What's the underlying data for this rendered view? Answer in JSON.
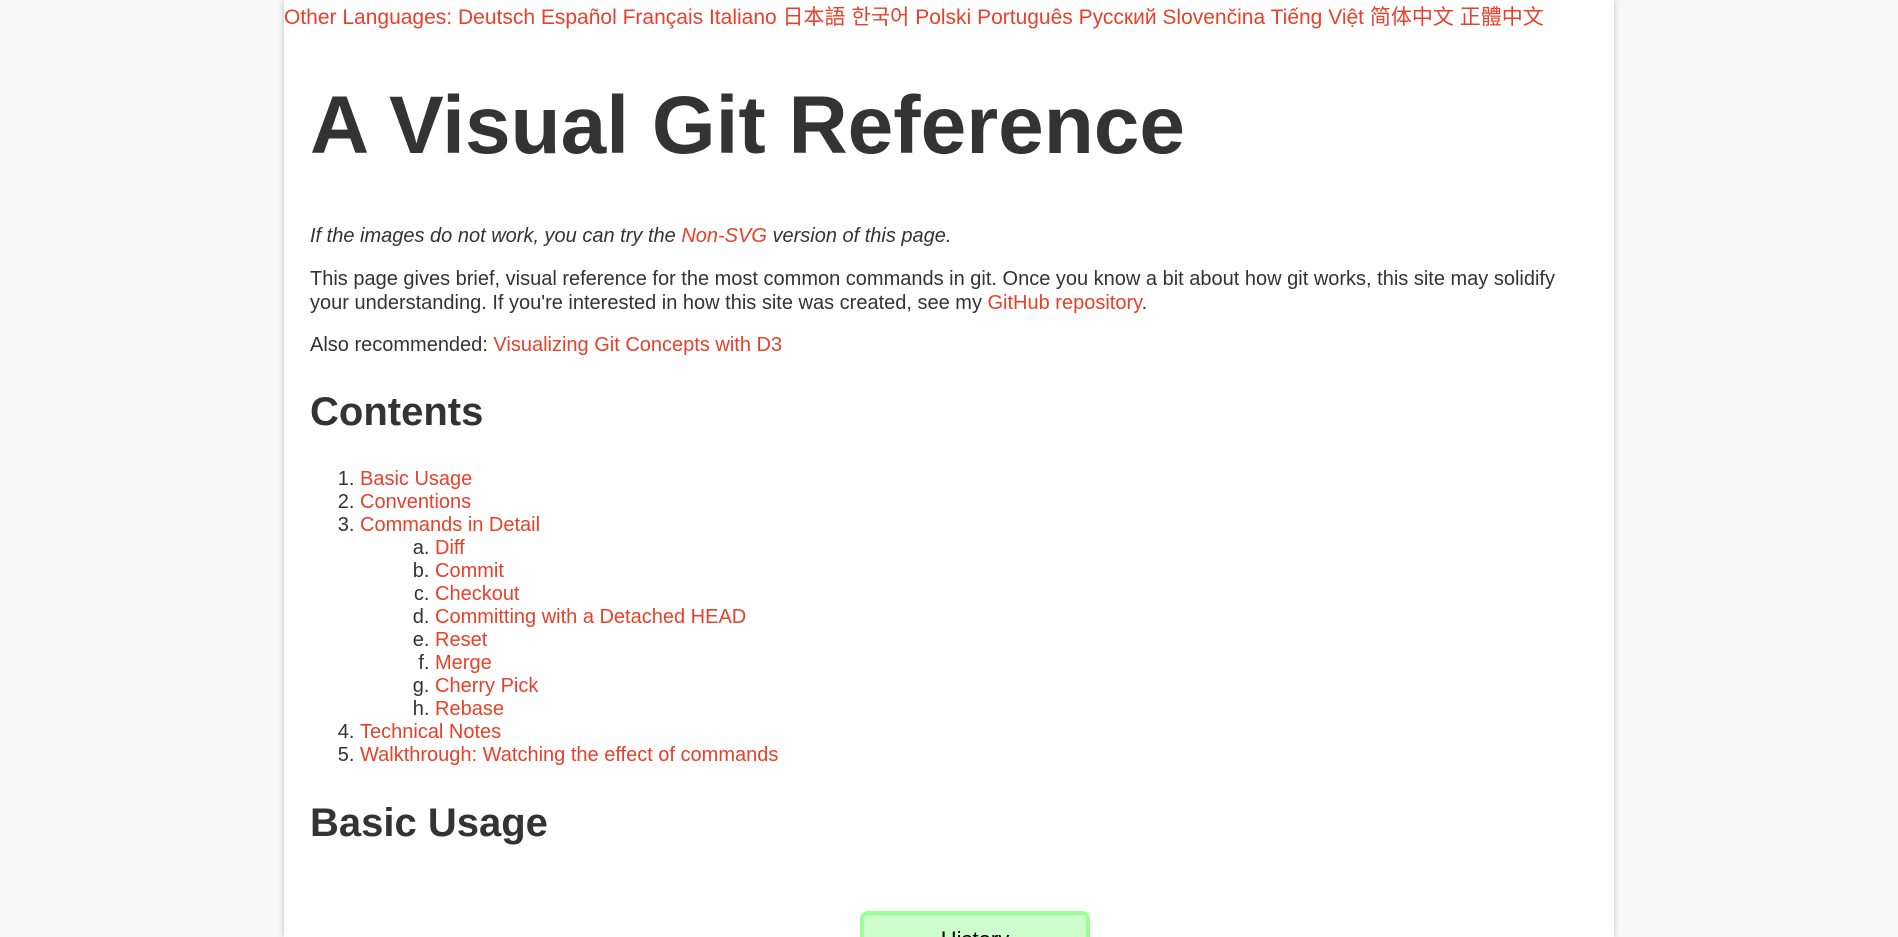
{
  "languages": {
    "label": "Other Languages:",
    "items": [
      "Deutsch",
      "Español",
      "Français",
      "Italiano",
      "日本語",
      "한국어",
      "Polski",
      "Português",
      "Русский",
      "Slovenčina",
      "Tiếng Việt",
      "简体中文",
      "正體中文"
    ]
  },
  "title": "A Visual Git Reference",
  "note": {
    "before": "If the images do not work, you can try the ",
    "link": "Non-SVG",
    "after": " version of this page."
  },
  "intro": {
    "text": "This page gives brief, visual reference for the most common commands in git. Once you know a bit about how git works, this site may solidify your understanding. If you're interested in how this site was created, see my ",
    "link": "GitHub repository",
    "end": "."
  },
  "also": {
    "label": "Also recommended: ",
    "link": "Visualizing Git Concepts with D3"
  },
  "contents_heading": "Contents",
  "toc": {
    "item1": "Basic Usage",
    "item2": "Conventions",
    "item3": "Commands in Detail",
    "sub": [
      "Diff",
      "Commit",
      "Checkout",
      "Committing with a Detached HEAD",
      "Reset",
      "Merge",
      "Cherry Pick",
      "Rebase"
    ],
    "item4": "Technical Notes",
    "item5": "Walkthrough: Watching the effect of commands"
  },
  "basic_usage_heading": "Basic Usage",
  "diagram": {
    "box_label": "History"
  }
}
